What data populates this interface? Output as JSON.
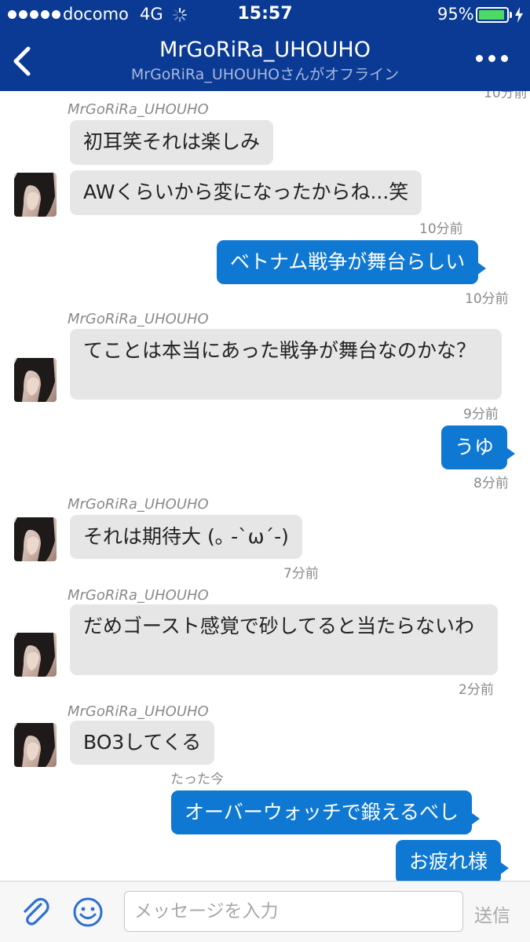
{
  "status_bar": {
    "carrier": "docomo",
    "network": "4G",
    "time": "15:57",
    "battery_percent": "95%",
    "battery_level": 0.95,
    "signal_bars": 5
  },
  "nav": {
    "title": "MrGoRiRa_UHOUHO",
    "subtitle": "MrGoRiRa_UHOUHOさんがオフライン",
    "accent_color": "#0a3a93"
  },
  "chat": {
    "top_cut_timestamp": "10分前",
    "messages": [
      {
        "sender": "MrGoRiRa_UHOUHO",
        "text": "初耳笑それは楽しみ"
      },
      {
        "text": "AWくらいから変になったからね...笑",
        "time": "10分前"
      },
      {
        "text": "ベトナム戦争が舞台らしい",
        "time": "10分前"
      },
      {
        "sender": "MrGoRiRa_UHOUHO",
        "text": "てことは本当にあった戦争が舞台なのかな？",
        "time": "9分前"
      },
      {
        "text": "うゆ",
        "time": "8分前"
      },
      {
        "sender": "MrGoRiRa_UHOUHO",
        "text": "それは期待大 (｡ -`ω´-)",
        "time": "7分前"
      },
      {
        "sender": "MrGoRiRa_UHOUHO",
        "text": "だめゴースト感覚で砂してると当たらないわ",
        "time": "2分前"
      },
      {
        "sender": "MrGoRiRa_UHOUHO",
        "text": "BO3してくる",
        "time": "たった今"
      },
      {
        "text": "オーバーウォッチで鍛えるべし"
      },
      {
        "text": "お疲れ様"
      }
    ],
    "outgoing_color": "#0f78d2",
    "incoming_color": "#e6e6e6"
  },
  "input": {
    "placeholder": "メッセージを入力",
    "send_label": "送信"
  },
  "icons": {
    "back": "chevron-left-icon",
    "more": "more-horizontal-icon",
    "attach": "paperclip-icon",
    "emoji": "smiley-icon",
    "avatar": "avatar"
  }
}
